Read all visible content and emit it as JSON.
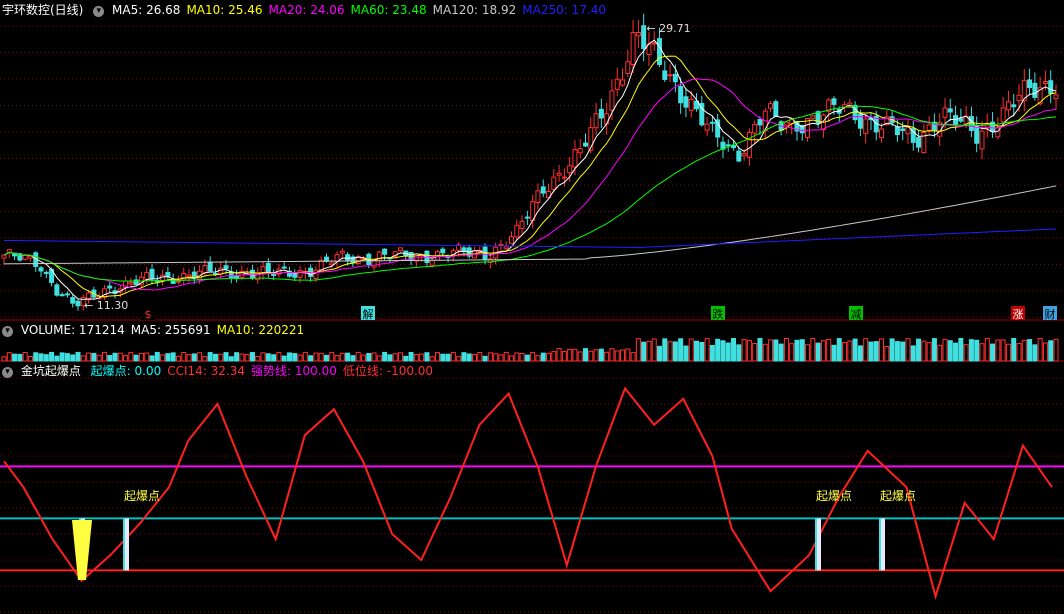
{
  "main_panel": {
    "title": "宇环数控(日线)",
    "toggle_icon": "collapse-icon",
    "indicators": [
      {
        "label": "MA5:",
        "value": "26.68",
        "color": "#ffffff"
      },
      {
        "label": "MA10:",
        "value": "25.46",
        "color": "#ffff00"
      },
      {
        "label": "MA20:",
        "value": "24.06",
        "color": "#ff00ff"
      },
      {
        "label": "MA60:",
        "value": "23.48",
        "color": "#00ff00"
      },
      {
        "label": "MA120:",
        "value": "18.92",
        "color": "#c8c8c8"
      },
      {
        "label": "MA250:",
        "value": "17.40",
        "color": "#2020ff"
      }
    ],
    "high_label": "29.71",
    "low_label": "11.30",
    "event_markers": [
      {
        "text": "$",
        "color": "#ff3030",
        "bg": "#000000"
      },
      {
        "text": "解",
        "color": "#000000",
        "bg": "#40e0e0"
      },
      {
        "text": "跌",
        "color": "#000000",
        "bg": "#00c000"
      },
      {
        "text": "减",
        "color": "#000000",
        "bg": "#00c000"
      },
      {
        "text": "涨",
        "color": "#ffffff",
        "bg": "#c00000"
      },
      {
        "text": "财",
        "color": "#000000",
        "bg": "#40a0e0"
      }
    ]
  },
  "volume_panel": {
    "toggle_icon": "collapse-icon",
    "indicators": [
      {
        "label": "VOLUME:",
        "value": "171214",
        "color": "#ffffff"
      },
      {
        "label": "MA5:",
        "value": "255691",
        "color": "#ffffff"
      },
      {
        "label": "MA10:",
        "value": "220221",
        "color": "#ffff00"
      }
    ]
  },
  "indicator_panel": {
    "title": "金坑起爆点",
    "toggle_icon": "collapse-icon",
    "indicators": [
      {
        "label": "起爆点:",
        "value": "0.00",
        "color": "#00ffff"
      },
      {
        "label": "CCI14:",
        "value": "32.34",
        "color": "#ff3030"
      },
      {
        "label": "强势线:",
        "value": "100.00",
        "color": "#ff00ff"
      },
      {
        "label": "低位线:",
        "value": "-100.00",
        "color": "#ff3030"
      }
    ],
    "signal_label": "起爆点"
  },
  "colors": {
    "up": "#ff3030",
    "down": "#40e0e0",
    "grid": "#8b0000",
    "cci": "#ff2020",
    "strong_line": "#ff00ff",
    "low_line": "#ff2020",
    "signal_line": "#00c0c0"
  },
  "chart_data": {
    "type": "candlestick",
    "price_range": [
      10.5,
      31.0
    ],
    "strong_line": 100,
    "signal_line": 0,
    "low_line": -100,
    "cci_range": [
      -180,
      270
    ]
  }
}
